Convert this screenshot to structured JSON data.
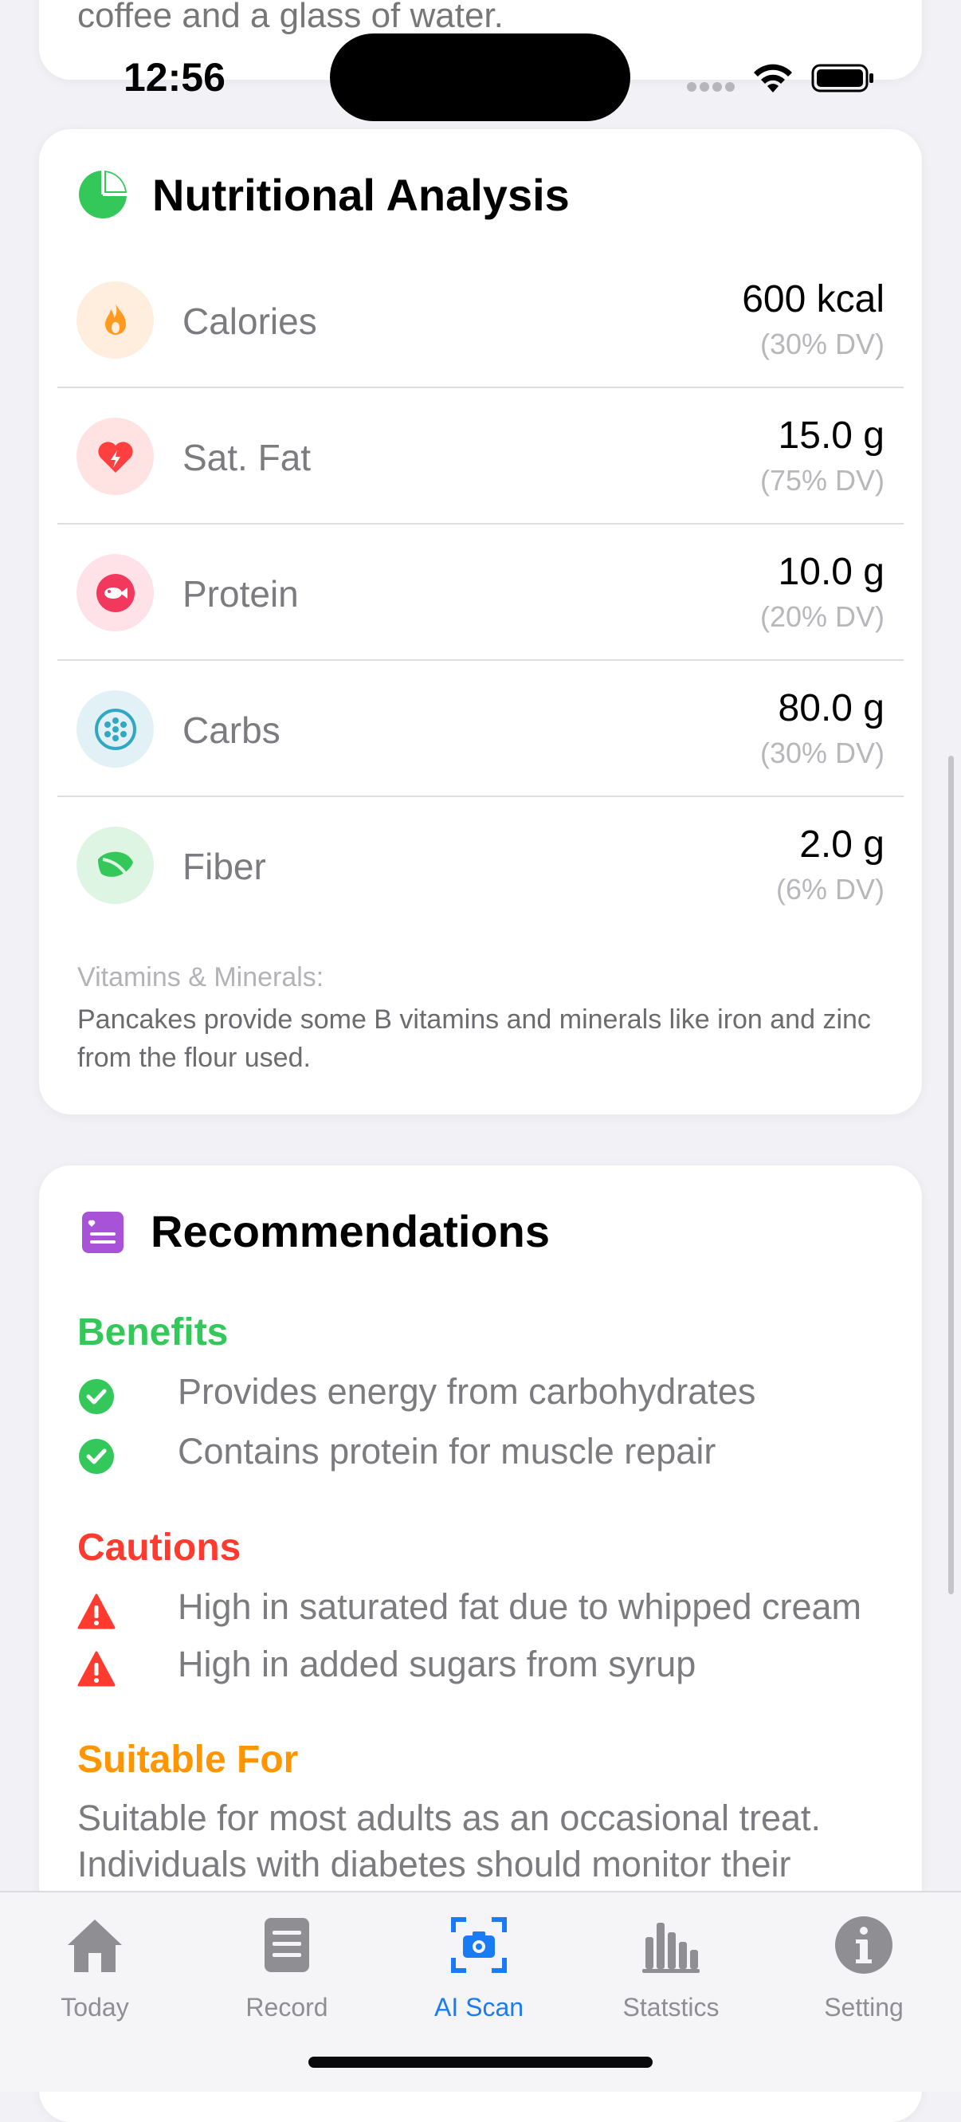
{
  "status_bar": {
    "time": "12:56"
  },
  "top_card": {
    "text": "coffee and a glass of water."
  },
  "nutrition": {
    "title": "Nutritional Analysis",
    "rows": [
      {
        "label": "Calories",
        "value": "600 kcal",
        "dv": "(30% DV)",
        "icon": "flame-icon",
        "icon_bg": "#ffeedd",
        "icon_color": "#ff9a1f"
      },
      {
        "label": "Sat. Fat",
        "value": "15.0 g",
        "dv": "(75% DV)",
        "icon": "heart-bolt-icon",
        "icon_bg": "#ffe3e3",
        "icon_color": "#ff4040"
      },
      {
        "label": "Protein",
        "value": "10.0 g",
        "dv": "(20% DV)",
        "icon": "fish-icon",
        "icon_bg": "#ffe1e8",
        "icon_color": "#f2385c"
      },
      {
        "label": "Carbs",
        "value": "80.0 g",
        "dv": "(30% DV)",
        "icon": "grain-icon",
        "icon_bg": "#e1f1f6",
        "icon_color": "#31a7c4"
      },
      {
        "label": "Fiber",
        "value": "2.0 g",
        "dv": "(6% DV)",
        "icon": "leaf-icon",
        "icon_bg": "#dff5e3",
        "icon_color": "#34c759"
      }
    ],
    "vitamins_label": "Vitamins & Minerals:",
    "vitamins_text": "Pancakes provide some B vitamins and minerals like iron and zinc from the flour used."
  },
  "recommendations": {
    "title": "Recommendations",
    "benefits_title": "Benefits",
    "benefits": [
      "Provides energy from carbohydrates",
      "Contains protein for muscle repair"
    ],
    "cautions_title": "Cautions",
    "cautions": [
      "High in saturated fat due to whipped cream",
      "High in added sugars from syrup"
    ],
    "suitable_title": "Suitable For",
    "suitable_text": "Suitable for most adults as an occasional treat. Individuals with diabetes should monitor their"
  },
  "tabs": [
    {
      "label": "Today",
      "icon": "house-icon",
      "active": false
    },
    {
      "label": "Record",
      "icon": "record-icon",
      "active": false
    },
    {
      "label": "AI Scan",
      "icon": "camera-scan-icon",
      "active": true
    },
    {
      "label": "Statstics",
      "icon": "bar-chart-icon",
      "active": false
    },
    {
      "label": "Setting",
      "icon": "info-icon",
      "active": false
    }
  ],
  "colors": {
    "benefits": "#34c759",
    "cautions": "#ff3b30",
    "suitable": "#ff9500",
    "active_tab": "#1a7cf5",
    "inactive_tab": "#8e8e93"
  }
}
